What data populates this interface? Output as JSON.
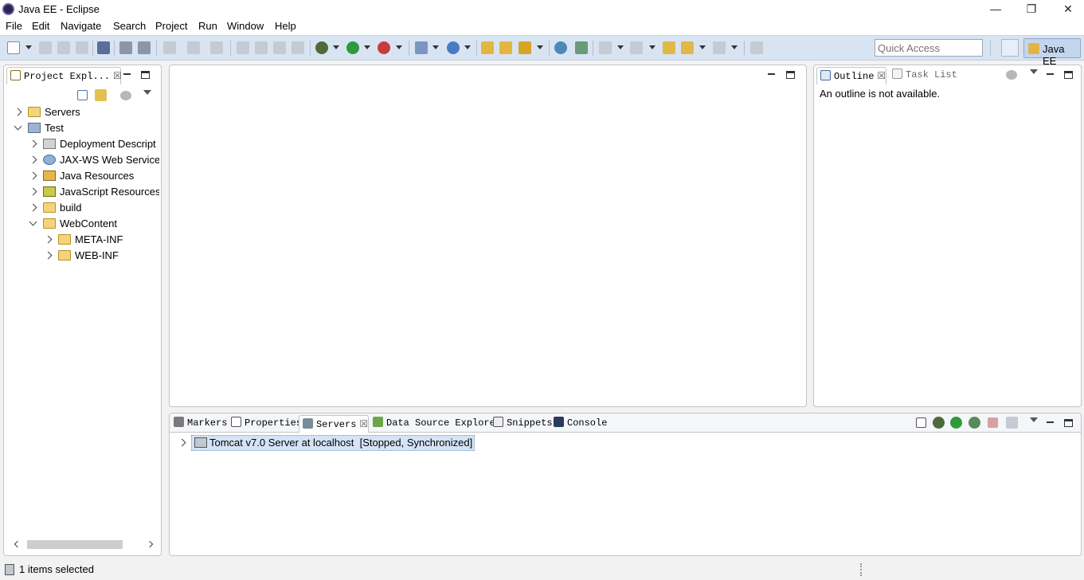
{
  "window": {
    "title": "Java EE - Eclipse",
    "minimize": "—",
    "restore": "❐",
    "close": "✕"
  },
  "menu": [
    "File",
    "Edit",
    "Navigate",
    "Search",
    "Project",
    "Run",
    "Window",
    "Help"
  ],
  "toolbar": {
    "quick_access_placeholder": "Quick Access",
    "perspective_label": "Java EE"
  },
  "project_explorer": {
    "tab_label": "Project Expl...",
    "tree": [
      {
        "label": "Servers",
        "expanded": false
      },
      {
        "label": "Test",
        "expanded": true
      },
      {
        "label": "Deployment Descript",
        "expanded": false
      },
      {
        "label": "JAX-WS Web Service",
        "expanded": false
      },
      {
        "label": "Java Resources",
        "expanded": false
      },
      {
        "label": "JavaScript Resources",
        "expanded": false
      },
      {
        "label": "build",
        "expanded": false
      },
      {
        "label": "WebContent",
        "expanded": true
      },
      {
        "label": "META-INF",
        "expanded": false
      },
      {
        "label": "WEB-INF",
        "expanded": false
      }
    ]
  },
  "outline": {
    "tabs": [
      "Outline",
      "Task List"
    ],
    "message": "An outline is not available."
  },
  "bottom": {
    "tabs": [
      "Markers",
      "Properties",
      "Servers",
      "Data Source Explorer",
      "Snippets",
      "Console"
    ],
    "active_tab": "Servers",
    "server_entry": "Tomcat v7.0 Server at localhost  [Stopped, Synchronized]"
  },
  "status": {
    "text": "1 items selected"
  },
  "colors": {
    "toolbar_bg": "#d9e4f2",
    "selection_bg": "#d4e3f5"
  }
}
